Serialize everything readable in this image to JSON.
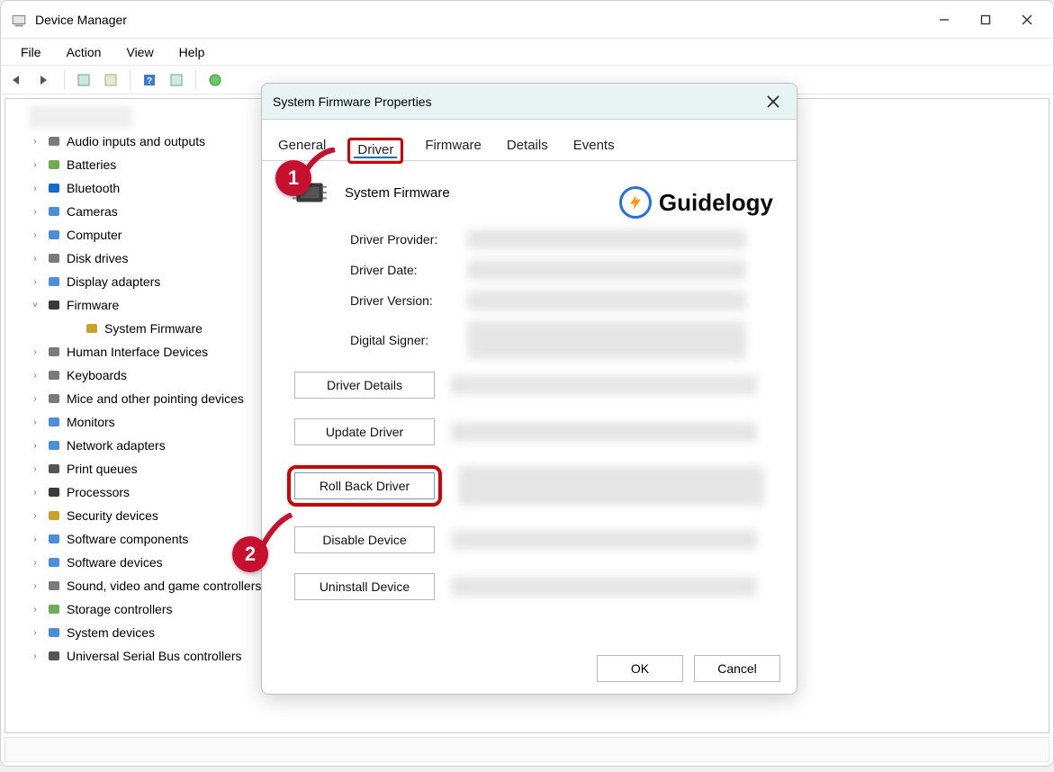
{
  "window": {
    "title": "Device Manager",
    "menus": [
      "File",
      "Action",
      "View",
      "Help"
    ]
  },
  "tree": {
    "items": [
      {
        "label": "Audio inputs and outputs",
        "expanded": false,
        "icon": "speaker"
      },
      {
        "label": "Batteries",
        "expanded": false,
        "icon": "battery"
      },
      {
        "label": "Bluetooth",
        "expanded": false,
        "icon": "bluetooth"
      },
      {
        "label": "Cameras",
        "expanded": false,
        "icon": "camera"
      },
      {
        "label": "Computer",
        "expanded": false,
        "icon": "computer"
      },
      {
        "label": "Disk drives",
        "expanded": false,
        "icon": "disk"
      },
      {
        "label": "Display adapters",
        "expanded": false,
        "icon": "display"
      },
      {
        "label": "Firmware",
        "expanded": true,
        "icon": "firmware",
        "children": [
          {
            "label": "System Firmware",
            "icon": "firmware-warn"
          }
        ]
      },
      {
        "label": "Human Interface Devices",
        "expanded": false,
        "icon": "hid"
      },
      {
        "label": "Keyboards",
        "expanded": false,
        "icon": "keyboard"
      },
      {
        "label": "Mice and other pointing devices",
        "expanded": false,
        "icon": "mouse"
      },
      {
        "label": "Monitors",
        "expanded": false,
        "icon": "monitor"
      },
      {
        "label": "Network adapters",
        "expanded": false,
        "icon": "network"
      },
      {
        "label": "Print queues",
        "expanded": false,
        "icon": "printer"
      },
      {
        "label": "Processors",
        "expanded": false,
        "icon": "processor"
      },
      {
        "label": "Security devices",
        "expanded": false,
        "icon": "security"
      },
      {
        "label": "Software components",
        "expanded": false,
        "icon": "swc"
      },
      {
        "label": "Software devices",
        "expanded": false,
        "icon": "swd"
      },
      {
        "label": "Sound, video and game controllers",
        "expanded": false,
        "icon": "sound"
      },
      {
        "label": "Storage controllers",
        "expanded": false,
        "icon": "storage"
      },
      {
        "label": "System devices",
        "expanded": false,
        "icon": "sysdev"
      },
      {
        "label": "Universal Serial Bus controllers",
        "expanded": false,
        "icon": "usb"
      }
    ]
  },
  "dialog": {
    "title": "System Firmware Properties",
    "tabs": [
      "General",
      "Driver",
      "Firmware",
      "Details",
      "Events"
    ],
    "active_tab": "Driver",
    "device_name": "System Firmware",
    "info_labels": {
      "provider": "Driver Provider:",
      "date": "Driver Date:",
      "version": "Driver Version:",
      "signer": "Digital Signer:"
    },
    "buttons": {
      "details": "Driver Details",
      "update": "Update Driver",
      "rollback": "Roll Back Driver",
      "disable": "Disable Device",
      "uninstall": "Uninstall Device",
      "ok": "OK",
      "cancel": "Cancel"
    }
  },
  "watermark": {
    "text": "Guidelogy"
  },
  "annotations": {
    "badge1": "1",
    "badge2": "2"
  }
}
